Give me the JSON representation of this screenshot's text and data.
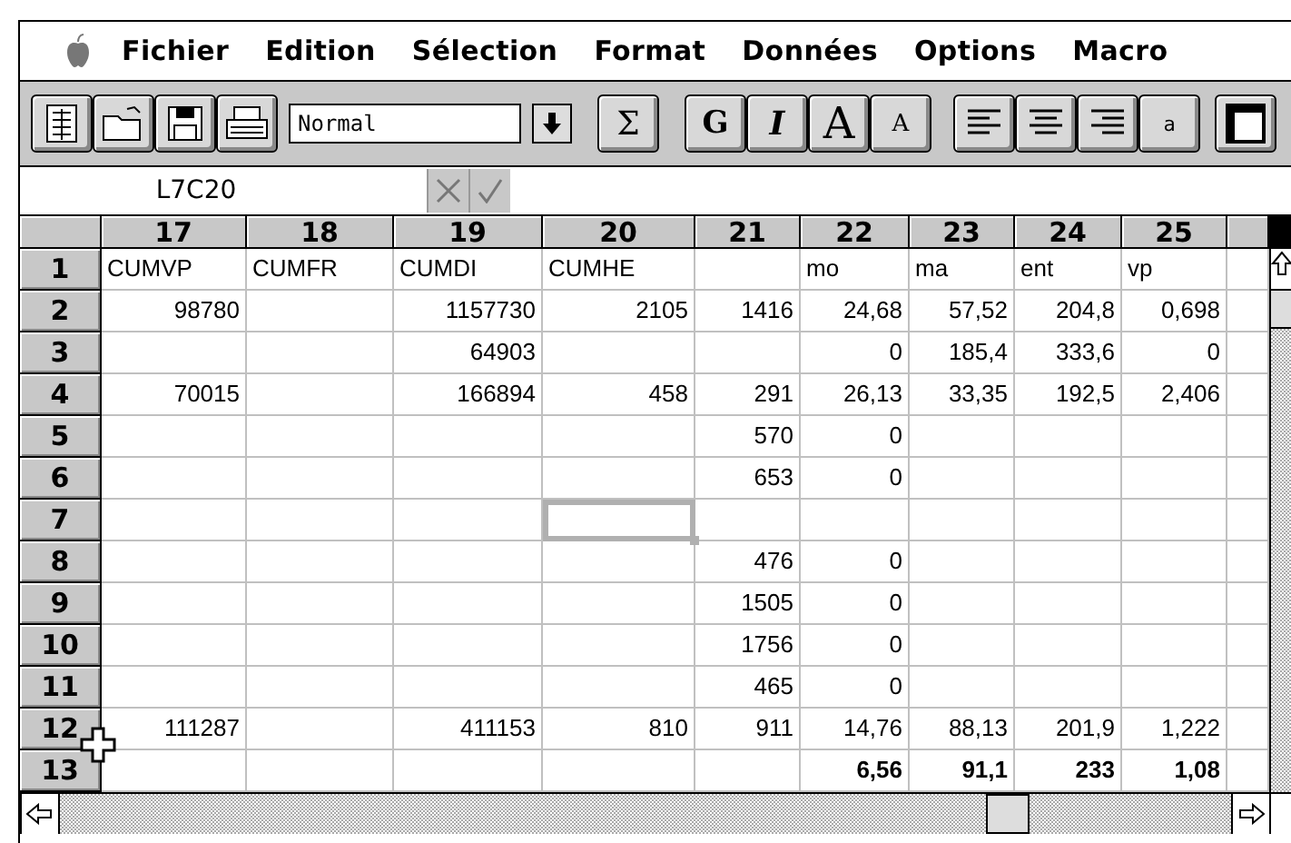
{
  "menu_bar": {
    "items": [
      "Fichier",
      "Edition",
      "Sélection",
      "Format",
      "Données",
      "Options",
      "Macro"
    ]
  },
  "toolbar": [
    {
      "kind": "new"
    },
    {
      "kind": "open"
    },
    {
      "kind": "save"
    },
    {
      "kind": "print"
    },
    {
      "kind": "style",
      "value": "Normal"
    },
    {
      "kind": "sum",
      "label": "Σ"
    },
    {
      "kind": "bold",
      "label": "G"
    },
    {
      "kind": "italic",
      "label": "I"
    },
    {
      "kind": "grow",
      "label": "A"
    },
    {
      "kind": "shrink",
      "label": "A"
    },
    {
      "kind": "align-left"
    },
    {
      "kind": "align-center"
    },
    {
      "kind": "align-right"
    },
    {
      "kind": "wrap",
      "label": "a"
    },
    {
      "kind": "frame"
    }
  ],
  "formula_bar": {
    "reference": "L7C20"
  },
  "sheet": {
    "columns": [
      "17",
      "18",
      "19",
      "20",
      "21",
      "22",
      "23",
      "24",
      "25"
    ],
    "rows": [
      {
        "label": "1",
        "kind": "labels",
        "bold": false,
        "cells": [
          {
            "text": "CUMVP",
            "selected": false
          },
          {
            "text": "CUMFR",
            "selected": false
          },
          {
            "text": "CUMDI",
            "selected": false
          },
          {
            "text": "CUMHE",
            "selected": false
          },
          {
            "selected": false
          },
          {
            "text": "mo",
            "selected": false
          },
          {
            "text": "ma",
            "selected": false
          },
          {
            "text": "ent",
            "selected": false
          },
          {
            "text": "vp",
            "selected": false
          }
        ]
      },
      {
        "label": "2",
        "kind": "values",
        "bold": false,
        "cells": [
          {
            "text": "98780",
            "selected": false
          },
          {
            "selected": false
          },
          {
            "text": "1157730",
            "selected": false
          },
          {
            "text": "2105",
            "selected": false
          },
          {
            "text": "1416",
            "selected": false
          },
          {
            "text": "24,68",
            "selected": false
          },
          {
            "text": "57,52",
            "selected": false
          },
          {
            "text": "204,8",
            "selected": false
          },
          {
            "text": "0,698",
            "selected": false
          }
        ]
      },
      {
        "label": "3",
        "kind": "values",
        "bold": false,
        "cells": [
          {
            "selected": false
          },
          {
            "selected": false
          },
          {
            "text": "64903",
            "selected": false
          },
          {
            "selected": false
          },
          {
            "selected": false
          },
          {
            "text": "0",
            "selected": false
          },
          {
            "text": "185,4",
            "selected": false
          },
          {
            "text": "333,6",
            "selected": false
          },
          {
            "text": "0",
            "selected": false
          }
        ]
      },
      {
        "label": "4",
        "kind": "values",
        "bold": false,
        "cells": [
          {
            "text": "70015",
            "selected": false
          },
          {
            "selected": false
          },
          {
            "text": "166894",
            "selected": false
          },
          {
            "text": "458",
            "selected": false
          },
          {
            "text": "291",
            "selected": false
          },
          {
            "text": "26,13",
            "selected": false
          },
          {
            "text": "33,35",
            "selected": false
          },
          {
            "text": "192,5",
            "selected": false
          },
          {
            "text": "2,406",
            "selected": false
          }
        ]
      },
      {
        "label": "5",
        "kind": "values",
        "bold": false,
        "cells": [
          {
            "selected": false
          },
          {
            "selected": false
          },
          {
            "selected": false
          },
          {
            "selected": false
          },
          {
            "text": "570",
            "selected": false
          },
          {
            "text": "0",
            "selected": false
          },
          {
            "selected": false
          },
          {
            "selected": false
          },
          {
            "selected": false
          }
        ]
      },
      {
        "label": "6",
        "kind": "values",
        "bold": false,
        "cells": [
          {
            "selected": false
          },
          {
            "selected": false
          },
          {
            "selected": false
          },
          {
            "selected": false
          },
          {
            "text": "653",
            "selected": false
          },
          {
            "text": "0",
            "selected": false
          },
          {
            "selected": false
          },
          {
            "selected": false
          },
          {
            "selected": false
          }
        ]
      },
      {
        "label": "7",
        "kind": "values",
        "bold": false,
        "cells": [
          {
            "selected": false
          },
          {
            "selected": false
          },
          {
            "selected": false
          },
          {
            "selected": true
          },
          {
            "selected": false
          },
          {
            "selected": false
          },
          {
            "selected": false
          },
          {
            "selected": false
          },
          {
            "selected": false
          }
        ]
      },
      {
        "label": "8",
        "kind": "values",
        "bold": false,
        "cells": [
          {
            "selected": false
          },
          {
            "selected": false
          },
          {
            "selected": false
          },
          {
            "selected": false
          },
          {
            "text": "476",
            "selected": false
          },
          {
            "text": "0",
            "selected": false
          },
          {
            "selected": false
          },
          {
            "selected": false
          },
          {
            "selected": false
          }
        ]
      },
      {
        "label": "9",
        "kind": "values",
        "bold": false,
        "cells": [
          {
            "selected": false
          },
          {
            "selected": false
          },
          {
            "selected": false
          },
          {
            "selected": false
          },
          {
            "text": "1505",
            "selected": false
          },
          {
            "text": "0",
            "selected": false
          },
          {
            "selected": false
          },
          {
            "selected": false
          },
          {
            "selected": false
          }
        ]
      },
      {
        "label": "10",
        "kind": "values",
        "bold": false,
        "cells": [
          {
            "selected": false
          },
          {
            "selected": false
          },
          {
            "selected": false
          },
          {
            "selected": false
          },
          {
            "text": "1756",
            "selected": false
          },
          {
            "text": "0",
            "selected": false
          },
          {
            "selected": false
          },
          {
            "selected": false
          },
          {
            "selected": false
          }
        ]
      },
      {
        "label": "11",
        "kind": "values",
        "bold": false,
        "cells": [
          {
            "selected": false
          },
          {
            "selected": false
          },
          {
            "selected": false
          },
          {
            "selected": false
          },
          {
            "text": "465",
            "selected": false
          },
          {
            "text": "0",
            "selected": false
          },
          {
            "selected": false
          },
          {
            "selected": false
          },
          {
            "selected": false
          }
        ]
      },
      {
        "label": "12",
        "kind": "values",
        "bold": false,
        "cells": [
          {
            "text": "111287",
            "selected": false
          },
          {
            "selected": false
          },
          {
            "text": "411153",
            "selected": false
          },
          {
            "text": "810",
            "selected": false
          },
          {
            "text": "911",
            "selected": false
          },
          {
            "text": "14,76",
            "selected": false
          },
          {
            "text": "88,13",
            "selected": false
          },
          {
            "text": "201,9",
            "selected": false
          },
          {
            "text": "1,222",
            "selected": false
          }
        ]
      },
      {
        "label": "13",
        "kind": "values",
        "bold": true,
        "cells": [
          {
            "selected": false
          },
          {
            "selected": false
          },
          {
            "selected": false
          },
          {
            "selected": false
          },
          {
            "selected": false
          },
          {
            "text": "6,56",
            "selected": false
          },
          {
            "text": "91,1",
            "selected": false
          },
          {
            "text": "233",
            "selected": false
          },
          {
            "text": "1,08",
            "selected": false
          }
        ]
      }
    ]
  }
}
